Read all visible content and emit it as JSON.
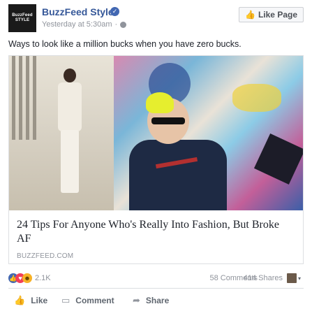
{
  "page": {
    "name": "BuzzFeed Style",
    "logo_text": "BuzzFeed STYLE",
    "timestamp": "Yesterday at 5:30am",
    "like_button": "Like Page"
  },
  "post": {
    "caption": "Ways to look like a million bucks when you have zero bucks."
  },
  "link": {
    "title": "24 Tips For Anyone Who's Really Into Fashion, But Broke AF",
    "domain": "BUZZFEED.COM"
  },
  "stats": {
    "reactions": "2.1K",
    "comments": "58 Comments",
    "shares": "414 Shares"
  },
  "actions": {
    "like": "Like",
    "comment": "Comment",
    "share": "Share"
  },
  "icons": {
    "verified": "verified-badge-icon",
    "globe": "globe-icon",
    "thumb": "thumbs-up-icon",
    "comment": "comment-icon",
    "share": "share-icon"
  },
  "colors": {
    "link_blue": "#365899",
    "fb_blue": "#4267b2",
    "muted": "#90949c",
    "love_red": "#f33e58",
    "haha_yellow": "#f7b125"
  }
}
